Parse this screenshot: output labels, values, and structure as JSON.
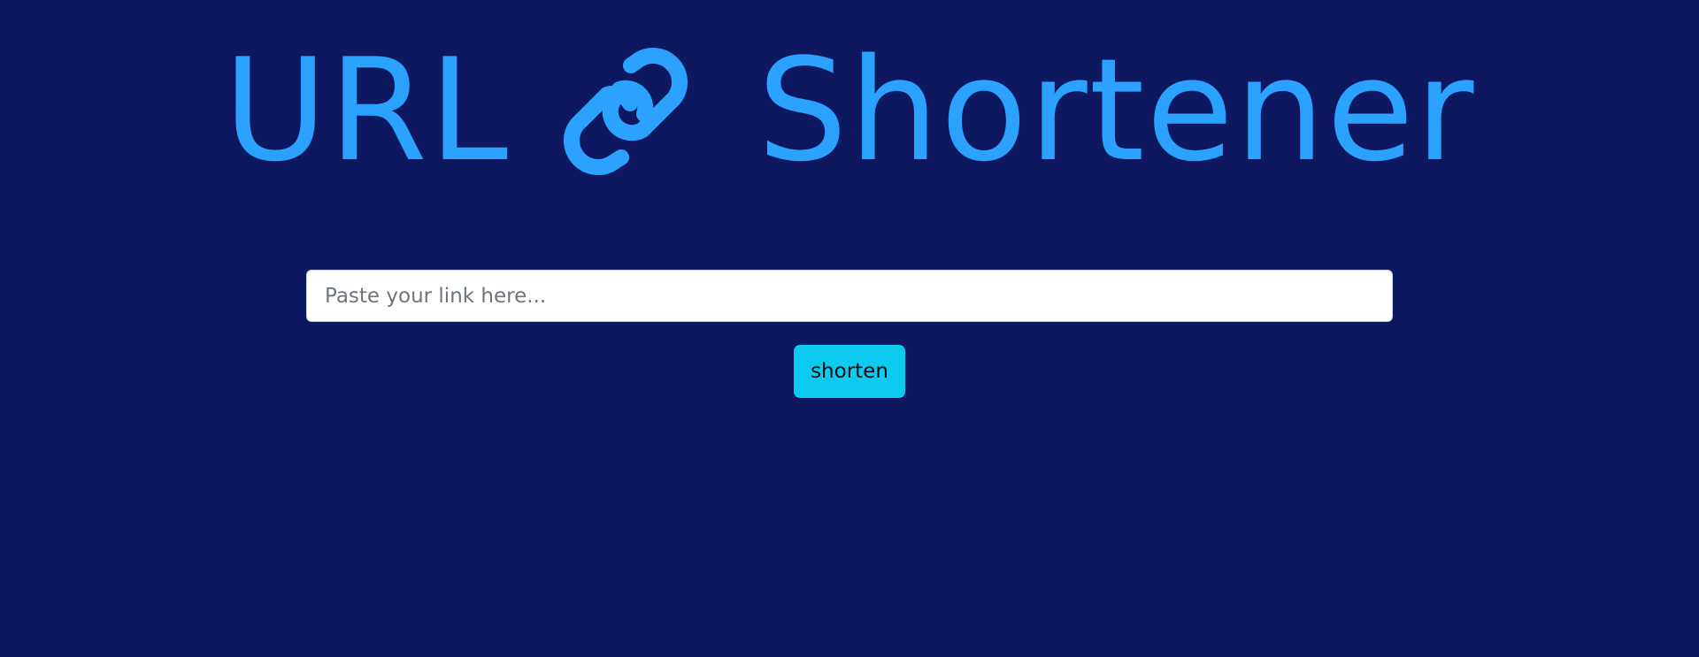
{
  "header": {
    "title_left": "URL",
    "title_right": "Shortener",
    "icon": "link-icon"
  },
  "form": {
    "url_placeholder": "Paste your link here...",
    "url_value": "",
    "shorten_label": "shorten"
  },
  "colors": {
    "background": "#0e1860",
    "accent": "#2ba2ff",
    "button": "#0dcaf0"
  }
}
